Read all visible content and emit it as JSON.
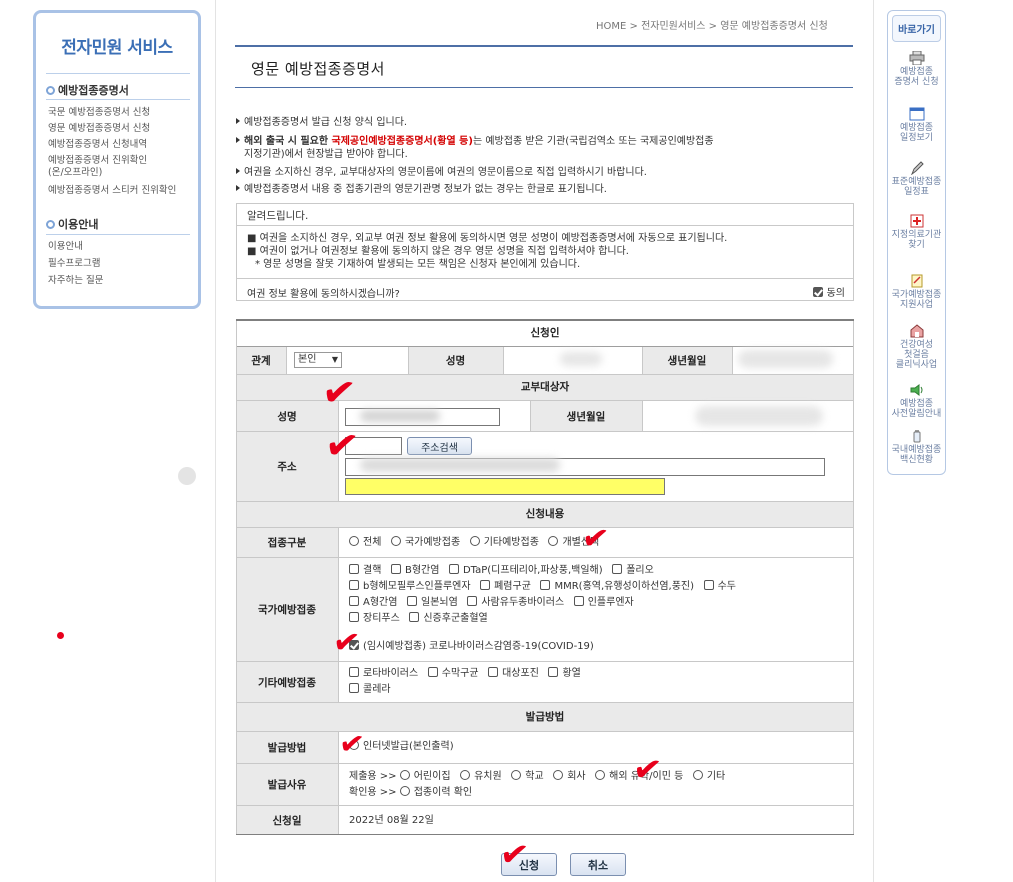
{
  "sidebar": {
    "title": "전자민원 서비스",
    "section1": "예방접종증명서",
    "items1": [
      "국문 예방접종증명서 신청",
      "영문 예방접종증명서 신청",
      "예방접종증명서 신청내역",
      "예방접종증명서 진위확인",
      "(온/오프라인)",
      "예방접종증명서 스티커 진위확인"
    ],
    "section2": "이용안내",
    "items2": [
      "이용안내",
      "필수프로그램",
      "자주하는 질문"
    ]
  },
  "breadcrumb": "HOME > 전자민원서비스 > 영문 예방접종증명서 신청",
  "page_title": "영문 예방접종증명서",
  "info": {
    "l1": "예방접종증명서 발급 신청 양식 입니다.",
    "l2a": "해외 출국 시 필요한 ",
    "l2b": "국제공인예방접종증명서(황열 등)",
    "l2c": "는 예방접종 받은 기관(국립검역소 또는 국제공인예방접종",
    "l2d": "지정기관)에서 현장발급 받아야 합니다.",
    "l3": "여권을 소지하신 경우, 교부대상자의 영문이름에 여권의 영문이름으로 직접 입력하시기 바랍니다.",
    "l4": "예방접종증명서 내용 중 접종기관의 영문기관명 정보가 없는 경우는 한글로 표기됩니다."
  },
  "notice": {
    "header": "알려드립니다.",
    "b1": "■ 여권을 소지하신 경우, 외교부 여권 정보 활용에 동의하시면 영문 성명이 예방접종증명서에 자동으로 표기됩니다.",
    "b2": "■ 여권이 없거나 여권정보 활용에 동의하지 않은 경우 영문 성명을 직접 입력하셔야 합니다.",
    "b3": "* 영문 성명을 잘못 기재하여 발생되는 모든 책임은 신청자 본인에게 있습니다.",
    "agree_q": "여권 정보 활용에 동의하시겠습니까?",
    "agree_label": "동의"
  },
  "form": {
    "applicant_title": "신청인",
    "rel_label": "관계",
    "rel_value": "본인",
    "name_label": "성명",
    "birth_label": "생년월일",
    "target_title": "교부대상자",
    "t_name_label": "성명",
    "t_name_value": "",
    "t_birth_label": "생년월일",
    "addr_label": "주소",
    "addr_btn": "주소검색",
    "content_title": "신청내용",
    "cat_label": "접종구분",
    "cat_opts": [
      "전체",
      "국가예방접종",
      "기타예방접종",
      "개별선택"
    ],
    "nat_label": "국가예방접종",
    "nat_opts": [
      "결핵",
      "B형간염",
      "DTaP(디프테리아,파상풍,백일해)",
      "폴리오",
      "b형헤모필루스인플루엔자",
      "폐렴구균",
      "MMR(홍역,유행성이하선염,풍진)",
      "수두",
      "A형간염",
      "일본뇌염",
      "사람유두종바이러스",
      "인플루엔자",
      "장티푸스",
      "신증후군출혈열",
      "(임시예방접종) 코로나바이러스감염증-19(COVID-19)"
    ],
    "etc_label": "기타예방접종",
    "etc_opts": [
      "로타바이러스",
      "수막구균",
      "대상포진",
      "황열",
      "콜레라"
    ],
    "issue_title": "발급방법",
    "method_label": "발급방법",
    "method_value": "인터넷발급(본인출력)",
    "reason_label": "발급사유",
    "reason_submit": "제출용 >>",
    "reason_opts": [
      "어린이집",
      "유치원",
      "학교",
      "회사",
      "해외 유학/이민 등",
      "기타"
    ],
    "reason_confirm": "확인용 >>",
    "reason_confirm_opt": "접종이력 확인",
    "date_label": "신청일",
    "date_value": "2022년 08월 22일",
    "submit": "신청",
    "cancel": "취소"
  },
  "quick": {
    "title": "바로가기",
    "items": [
      {
        "l1": "예방접종",
        "l2": "증명서 신청",
        "icon": "printer-icon"
      },
      {
        "l1": "예방접종",
        "l2": "일정보기",
        "icon": "calendar-icon"
      },
      {
        "l1": "표준예방접종",
        "l2": "일정표",
        "icon": "pen-icon"
      },
      {
        "l1": "지정의료기관",
        "l2": "찾기",
        "icon": "hospital-icon"
      },
      {
        "l1": "국가예방접종",
        "l2": "지원사업",
        "icon": "memo-icon"
      },
      {
        "l1": "건강여성",
        "l2": "첫걸음",
        "l3": "클리닉사업",
        "icon": "clinic-icon"
      },
      {
        "l1": "예방접종",
        "l2": "사전알림안내",
        "icon": "speaker-icon"
      },
      {
        "l1": "국내예방접종",
        "l2": "백신현황",
        "icon": "vaccine-icon"
      }
    ]
  },
  "colors": {
    "accent": "#3b6fb6",
    "highlight": "#ffff66",
    "marker": "#e8001c"
  }
}
